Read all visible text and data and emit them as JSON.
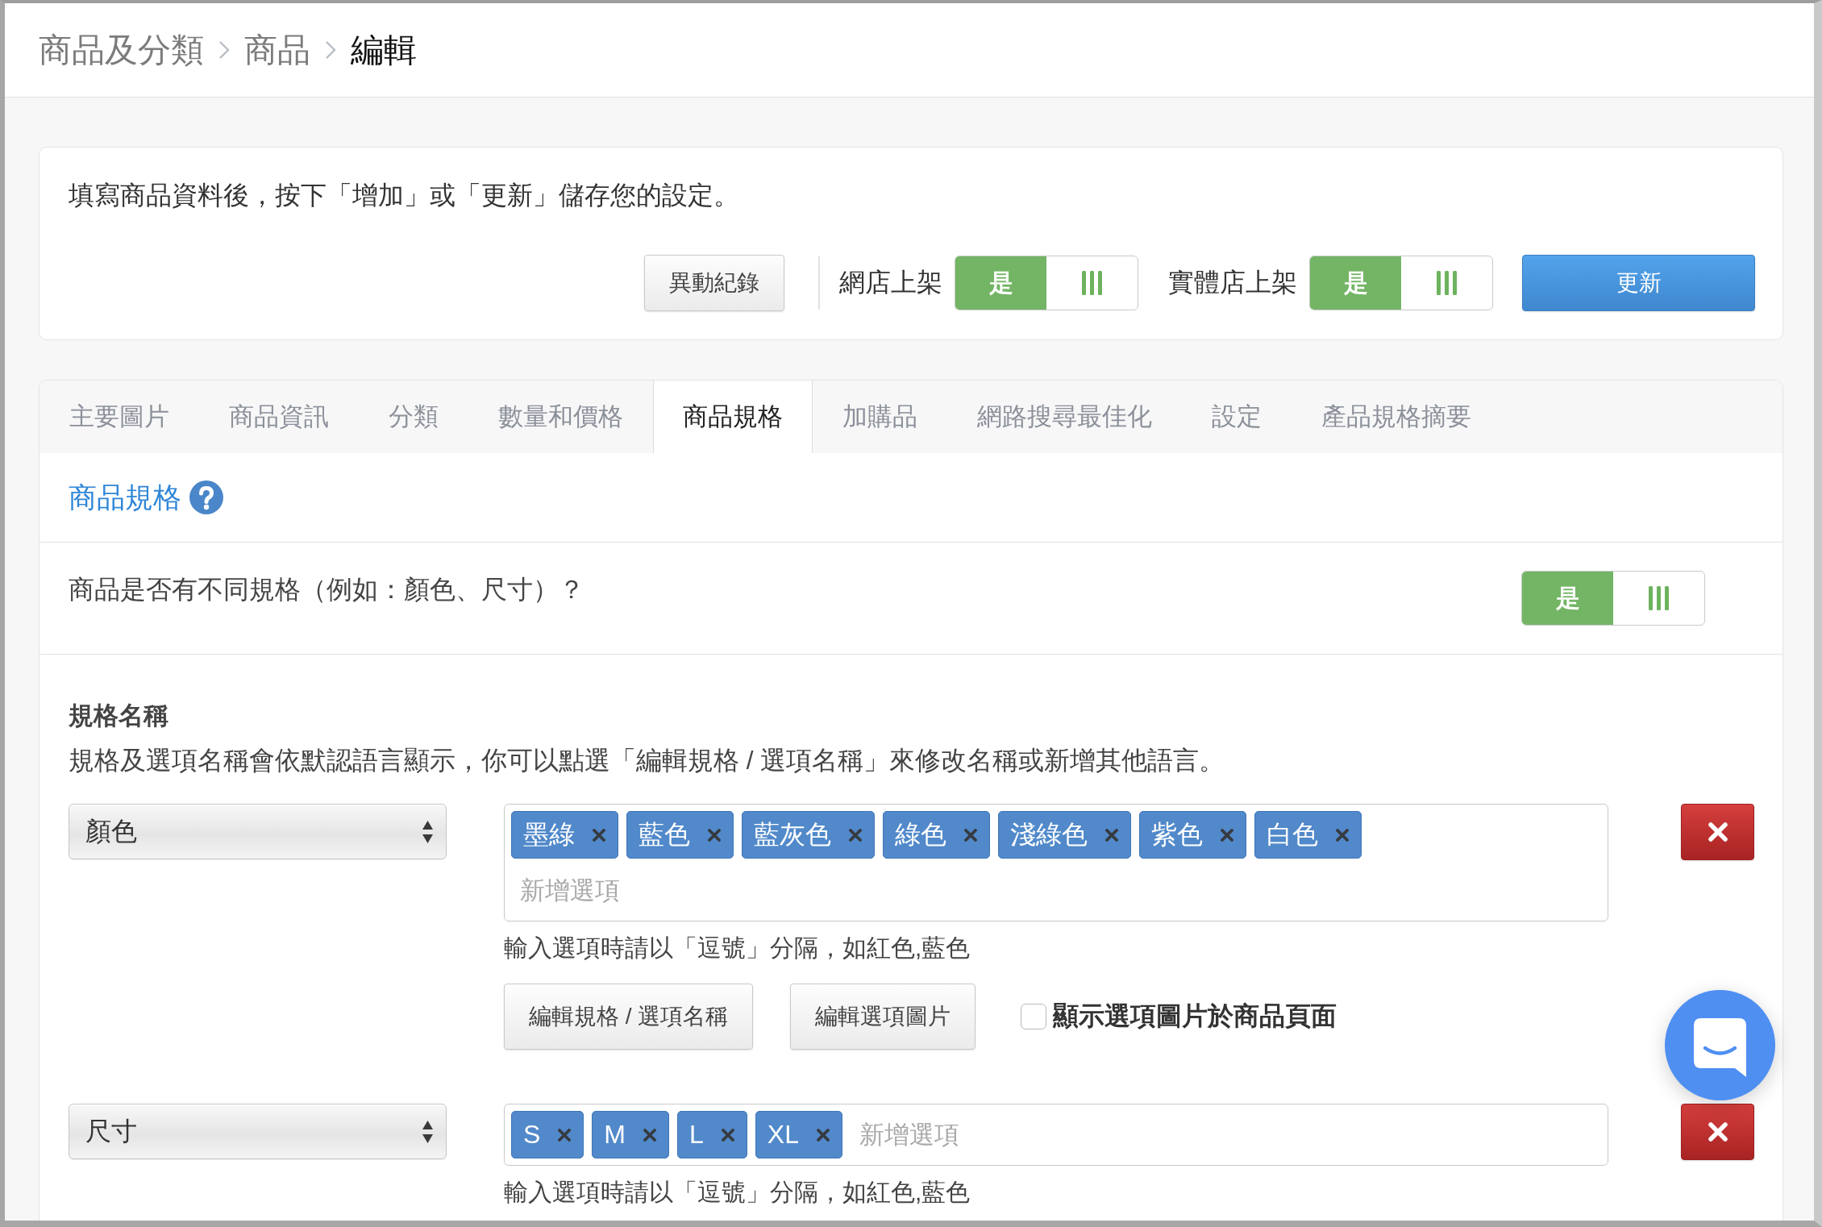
{
  "breadcrumb": [
    {
      "label": "商品及分類",
      "current": false
    },
    {
      "label": "商品",
      "current": false
    },
    {
      "label": "編輯",
      "current": true
    }
  ],
  "notice": {
    "text": "填寫商品資料後，按下「增加」或「更新」儲存您的設定。",
    "history_button": "異動紀錄",
    "toggles": [
      {
        "label": "網店上架",
        "on_label": "是",
        "on": true
      },
      {
        "label": "實體店上架",
        "on_label": "是",
        "on": true
      }
    ],
    "update_button": "更新"
  },
  "tabs": [
    {
      "label": "主要圖片",
      "selected": false
    },
    {
      "label": "商品資訊",
      "selected": false
    },
    {
      "label": "分類",
      "selected": false
    },
    {
      "label": "數量和價格",
      "selected": false
    },
    {
      "label": "商品規格",
      "selected": true
    },
    {
      "label": "加購品",
      "selected": false
    },
    {
      "label": "網路搜尋最佳化",
      "selected": false
    },
    {
      "label": "設定",
      "selected": false
    },
    {
      "label": "產品規格摘要",
      "selected": false
    }
  ],
  "panel": {
    "title": "商品規格",
    "variant_question": "商品是否有不同規格（例如：顏色、尺寸）？",
    "variant_toggle": {
      "on_label": "是",
      "on": true
    },
    "spec_names": {
      "heading": "規格名稱",
      "description": "規格及選項名稱會依默認語言顯示，你可以點選「編輯規格 / 選項名稱」來修改名稱或新增其他語言。",
      "specs": [
        {
          "name": "顏色",
          "options": [
            "墨綠",
            "藍色",
            "藍灰色",
            "綠色",
            "淺綠色",
            "紫色",
            "白色"
          ],
          "placeholder": "新增選項",
          "hint": "輸入選項時請以「逗號」分隔，如紅色,藍色",
          "buttons": [
            "編輯規格 / 選項名稱",
            "編輯選項圖片"
          ],
          "show_images": {
            "label": "顯示選項圖片於商品頁面",
            "checked": false
          }
        },
        {
          "name": "尺寸",
          "options": [
            "S",
            "M",
            "L",
            "XL"
          ],
          "placeholder": "新增選項",
          "hint": "輸入選項時請以「逗號」分隔，如紅色,藍色"
        }
      ]
    }
  }
}
